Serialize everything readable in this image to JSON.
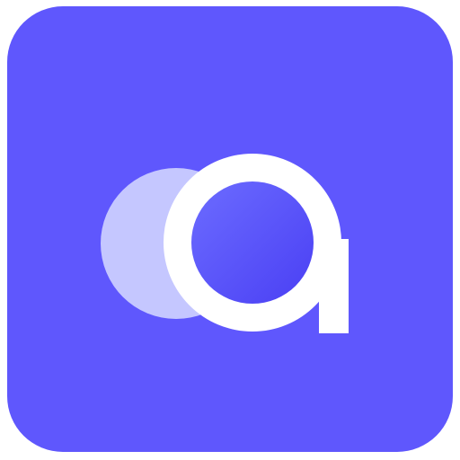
{
  "icon": {
    "name": "app-logo-icon",
    "glyph": "a",
    "colors": {
      "tile": "#5f57fd",
      "back_circle": "#c5c7ff",
      "ring": "#ffffff",
      "inner_disc_light": "#6c6cff",
      "inner_disc_dark": "#4a3ff4",
      "outer_background": "#ffffff"
    }
  }
}
